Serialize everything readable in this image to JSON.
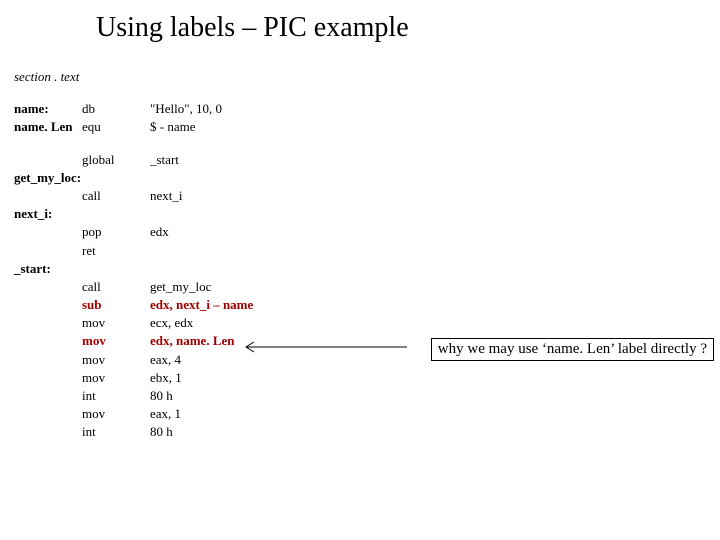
{
  "title": "Using labels – PIC example",
  "section_line": "section . text",
  "rows": [
    {
      "label": "name:",
      "labelBold": true,
      "mnem": "db",
      "oper": "\"Hello\", 10, 0"
    },
    {
      "label": "name. Len",
      "labelBold": true,
      "mnem": "equ",
      "oper": "$ - name"
    },
    {
      "spacer": true
    },
    {
      "label": "",
      "mnem": "global",
      "oper": "_start"
    },
    {
      "label": "get_my_loc:",
      "labelBold": true,
      "mnem": "",
      "oper": ""
    },
    {
      "label": "",
      "mnem": "call",
      "oper": "next_i"
    },
    {
      "label": "next_i:",
      "labelBold": true,
      "mnem": "",
      "oper": ""
    },
    {
      "label": "",
      "mnem": "pop",
      "oper": "edx"
    },
    {
      "label": "",
      "mnem": "ret",
      "oper": ""
    },
    {
      "label": "_start:",
      "labelBold": true,
      "mnem": "",
      "oper": ""
    },
    {
      "label": "",
      "mnem": "call",
      "oper": "get_my_loc"
    },
    {
      "label": "",
      "mnemRed": true,
      "mnem": "sub",
      "operRed": true,
      "oper": "edx,  next_i – name"
    },
    {
      "label": "",
      "mnem": "mov",
      "oper": "ecx, edx"
    },
    {
      "label": "",
      "mnemRed": true,
      "mnem": "mov",
      "operRed": true,
      "oper": "edx, name. Len"
    },
    {
      "label": "",
      "mnem": "mov",
      "oper": "eax, 4"
    },
    {
      "label": "",
      "mnem": "mov",
      "oper": "ebx, 1"
    },
    {
      "label": "",
      "mnem": "int",
      "oper": "80 h"
    },
    {
      "label": "",
      "mnem": "mov",
      "oper": "eax, 1"
    },
    {
      "label": "",
      "mnem": "int",
      "oper": "80 h"
    }
  ],
  "annotation": "why we may use ‘name. Len’ label directly ?"
}
